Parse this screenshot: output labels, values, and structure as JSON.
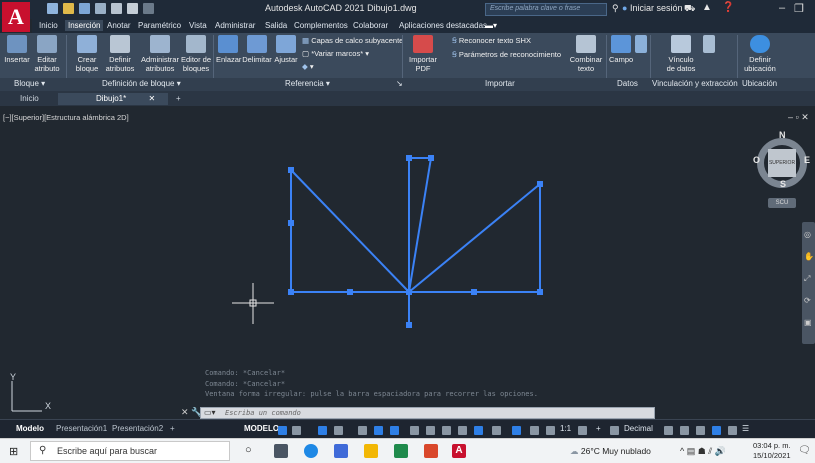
{
  "app": {
    "logo_letter": "A",
    "title": "Autodesk AutoCAD 2021   Dibujo1.dwg",
    "search_placeholder": "Escribe palabra clave o frase",
    "signin_label": "Iniciar sesión",
    "window_controls": [
      "minimize-icon",
      "restore-icon"
    ]
  },
  "ribbon_tabs": [
    "Inicio",
    "Inserción",
    "Anotar",
    "Paramétrico",
    "Vista",
    "Administrar",
    "Salida",
    "Complementos",
    "Colaborar",
    "Aplicaciones destacadas"
  ],
  "active_tab": "Inserción",
  "ribbon_tools": {
    "insertar": "Insertar",
    "editar_atributo": [
      "Editar",
      "atributo"
    ],
    "crear_bloque": [
      "Crear",
      "bloque"
    ],
    "definir_atributos": [
      "Definir",
      "atributos"
    ],
    "administrar_atributos": [
      "Administrar",
      "atributos"
    ],
    "editor_bloques": [
      "Editor de",
      "bloques"
    ],
    "enlazar": "Enlazar",
    "delimitar": "Delimitar",
    "ajustar": "Ajustar",
    "capas_calco": "Capas de calco subyacente",
    "variar_marcos": "*Variar marcos*",
    "importar_pdf": [
      "Importar",
      "PDF"
    ],
    "reconocer_shx": "Reconocer texto SHX",
    "parametros_reconocimiento": "Parámetros de reconocimiento",
    "combinar_texto": [
      "Combinar",
      "texto"
    ],
    "campo": "Campo",
    "vinculo_datos": [
      "Vínculo",
      "de datos"
    ],
    "definir_ubicacion": [
      "Definir",
      "ubicación"
    ]
  },
  "panel_labels": [
    "Bloque",
    "Definición de bloque",
    "Referencia",
    "Importar",
    "Datos",
    "Vinculación y extracción",
    "Ubicación"
  ],
  "file_tabs": [
    "Inicio",
    "Dibujo1*"
  ],
  "viewport": {
    "label": "[−][Superior][Estructura alámbrica 2D]",
    "viewcube": {
      "N": "N",
      "S": "S",
      "E": "E",
      "O": "O",
      "face": "SUPERIOR",
      "wcs": "SCU"
    }
  },
  "command": {
    "history": [
      "Comando: *Cancelar*",
      "Comando: *Cancelar*",
      "Ventana forma irregular: pulse la barra espaciadora para recorrer las opciones."
    ],
    "placeholder": "Escriba un comando"
  },
  "layout_tabs": [
    "Modelo",
    "Presentación1",
    "Presentación2"
  ],
  "status": {
    "model": "MODELO",
    "scale": "1:1",
    "units": "Decimal"
  },
  "taskbar": {
    "search": "Escribe aquí para buscar",
    "weather": "26°C  Muy nublado",
    "time": "03:04 p. m.",
    "date": "15/10/2021"
  },
  "colors": {
    "accent": "#2e7fe6",
    "drawing": "#3b82f6",
    "logo": "#c8102e",
    "ribbon": "#3b4a5c",
    "background": "#212830"
  }
}
